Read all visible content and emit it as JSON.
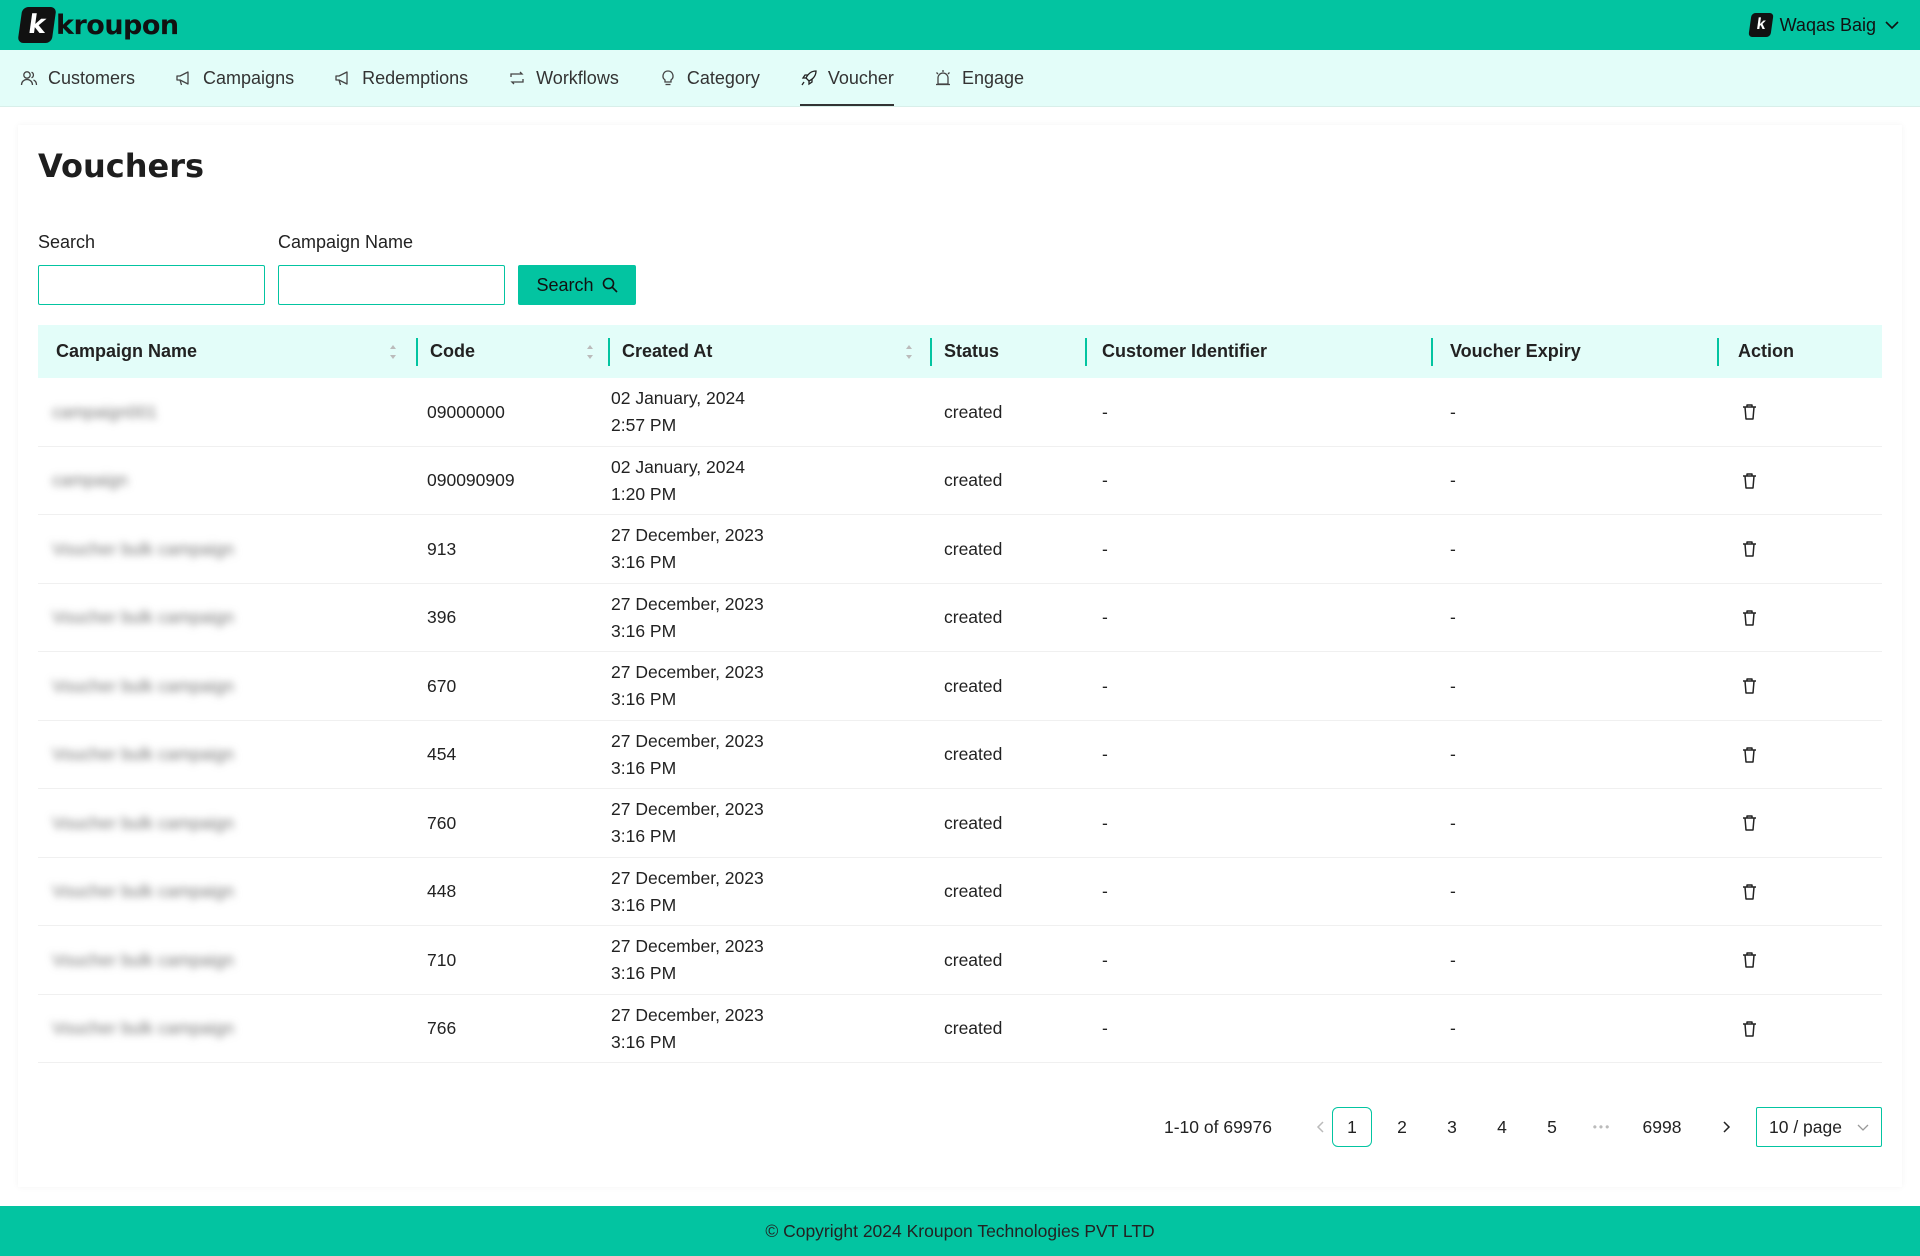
{
  "brand": {
    "logo_letter": "k",
    "logo_text": "kroupon",
    "accent": "#03c4a1",
    "nav_bg": "#e3fdf9"
  },
  "user": {
    "avatar_letter": "k",
    "name": "Waqas Baig"
  },
  "nav": [
    {
      "label": "Customers",
      "icon": "users-icon"
    },
    {
      "label": "Campaigns",
      "icon": "megaphone-icon"
    },
    {
      "label": "Redemptions",
      "icon": "megaphone-icon"
    },
    {
      "label": "Workflows",
      "icon": "retweet-icon"
    },
    {
      "label": "Category",
      "icon": "bulb-icon"
    },
    {
      "label": "Voucher",
      "icon": "rocket-icon",
      "active": true
    },
    {
      "label": "Engage",
      "icon": "alarm-icon"
    }
  ],
  "page": {
    "title": "Vouchers"
  },
  "filters": {
    "search_label": "Search",
    "search_value": "",
    "campaign_label": "Campaign Name",
    "campaign_value": "",
    "button_label": "Search"
  },
  "table": {
    "columns": [
      "Campaign Name",
      "Code",
      "Created At",
      "Status",
      "Customer Identifier",
      "Voucher Expiry",
      "Action"
    ],
    "rows": [
      {
        "campaign": "campaign001",
        "code": "09000000",
        "date": "02 January, 2024",
        "time": "2:57 PM",
        "status": "created",
        "customer": "-",
        "expiry": "-"
      },
      {
        "campaign": "campaign",
        "code": "090090909",
        "date": "02 January, 2024",
        "time": "1:20 PM",
        "status": "created",
        "customer": "-",
        "expiry": "-"
      },
      {
        "campaign": "Voucher bulk campaign",
        "code": "913",
        "date": "27 December, 2023",
        "time": "3:16 PM",
        "status": "created",
        "customer": "-",
        "expiry": "-"
      },
      {
        "campaign": "Voucher bulk campaign",
        "code": "396",
        "date": "27 December, 2023",
        "time": "3:16 PM",
        "status": "created",
        "customer": "-",
        "expiry": "-"
      },
      {
        "campaign": "Voucher bulk campaign",
        "code": "670",
        "date": "27 December, 2023",
        "time": "3:16 PM",
        "status": "created",
        "customer": "-",
        "expiry": "-"
      },
      {
        "campaign": "Voucher bulk campaign",
        "code": "454",
        "date": "27 December, 2023",
        "time": "3:16 PM",
        "status": "created",
        "customer": "-",
        "expiry": "-"
      },
      {
        "campaign": "Voucher bulk campaign",
        "code": "760",
        "date": "27 December, 2023",
        "time": "3:16 PM",
        "status": "created",
        "customer": "-",
        "expiry": "-"
      },
      {
        "campaign": "Voucher bulk campaign",
        "code": "448",
        "date": "27 December, 2023",
        "time": "3:16 PM",
        "status": "created",
        "customer": "-",
        "expiry": "-"
      },
      {
        "campaign": "Voucher bulk campaign",
        "code": "710",
        "date": "27 December, 2023",
        "time": "3:16 PM",
        "status": "created",
        "customer": "-",
        "expiry": "-"
      },
      {
        "campaign": "Voucher bulk campaign",
        "code": "766",
        "date": "27 December, 2023",
        "time": "3:16 PM",
        "status": "created",
        "customer": "-",
        "expiry": "-"
      }
    ]
  },
  "pagination": {
    "total_text": "1-10 of 69976",
    "pages": [
      "1",
      "2",
      "3",
      "4",
      "5"
    ],
    "ellipsis": "•••",
    "last_page": "6998",
    "current": "1",
    "page_size": "10 / page"
  },
  "footer": {
    "text": "© Copyright 2024 Kroupon Technologies PVT LTD"
  }
}
